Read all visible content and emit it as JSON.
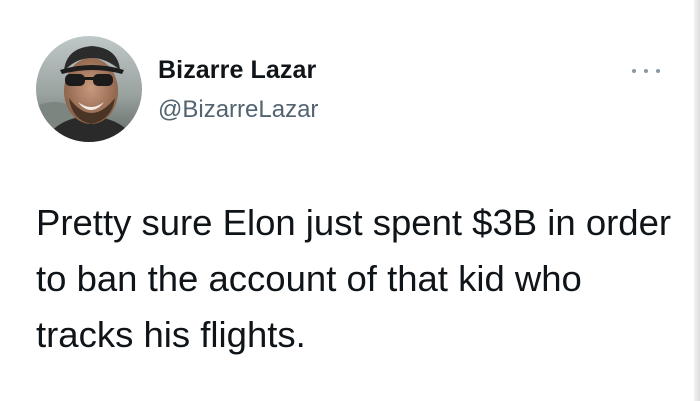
{
  "author": {
    "display_name": "Bizarre Lazar",
    "handle": "@BizarreLazar",
    "avatar_icon": "profile-photo"
  },
  "menu": {
    "icon": "more-horizontal-icon"
  },
  "tweet": {
    "text": "Pretty sure Elon just spent $3B in order to ban the account of that kid who tracks his flights."
  },
  "colors": {
    "text_primary": "#0f1419",
    "text_secondary": "#536471",
    "background": "#ffffff"
  }
}
